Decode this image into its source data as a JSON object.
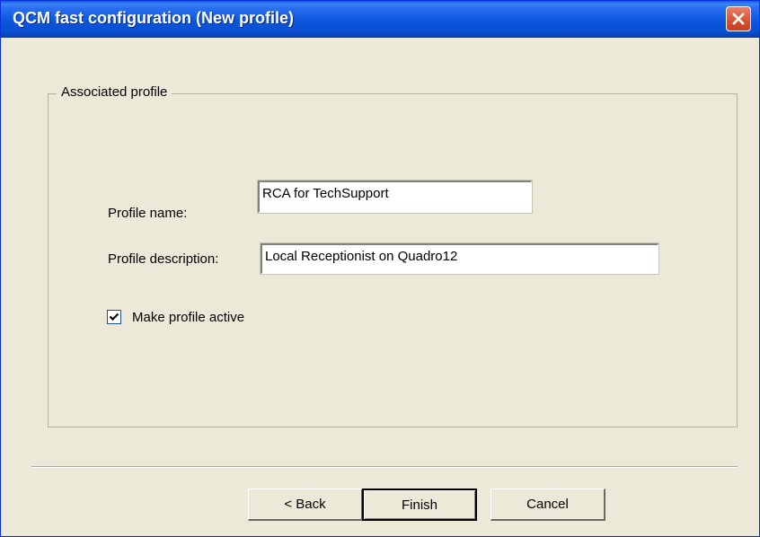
{
  "window": {
    "title": "QCM fast configuration (New profile)"
  },
  "group": {
    "legend": "Associated profile"
  },
  "profile_name": {
    "label": "Profile name:",
    "value": "RCA for TechSupport"
  },
  "profile_description": {
    "label": "Profile description:",
    "value": "Local Receptionist on Quadro12"
  },
  "make_active": {
    "label": "Make profile active",
    "checked": true
  },
  "buttons": {
    "back": "< Back",
    "finish": "Finish",
    "cancel": "Cancel"
  },
  "colors": {
    "titlebar": "#0a4fd0",
    "dialog_bg": "#ece9d8",
    "close_button": "#d8502f"
  },
  "icons": {
    "close": "close-icon",
    "check": "checkmark-icon"
  }
}
